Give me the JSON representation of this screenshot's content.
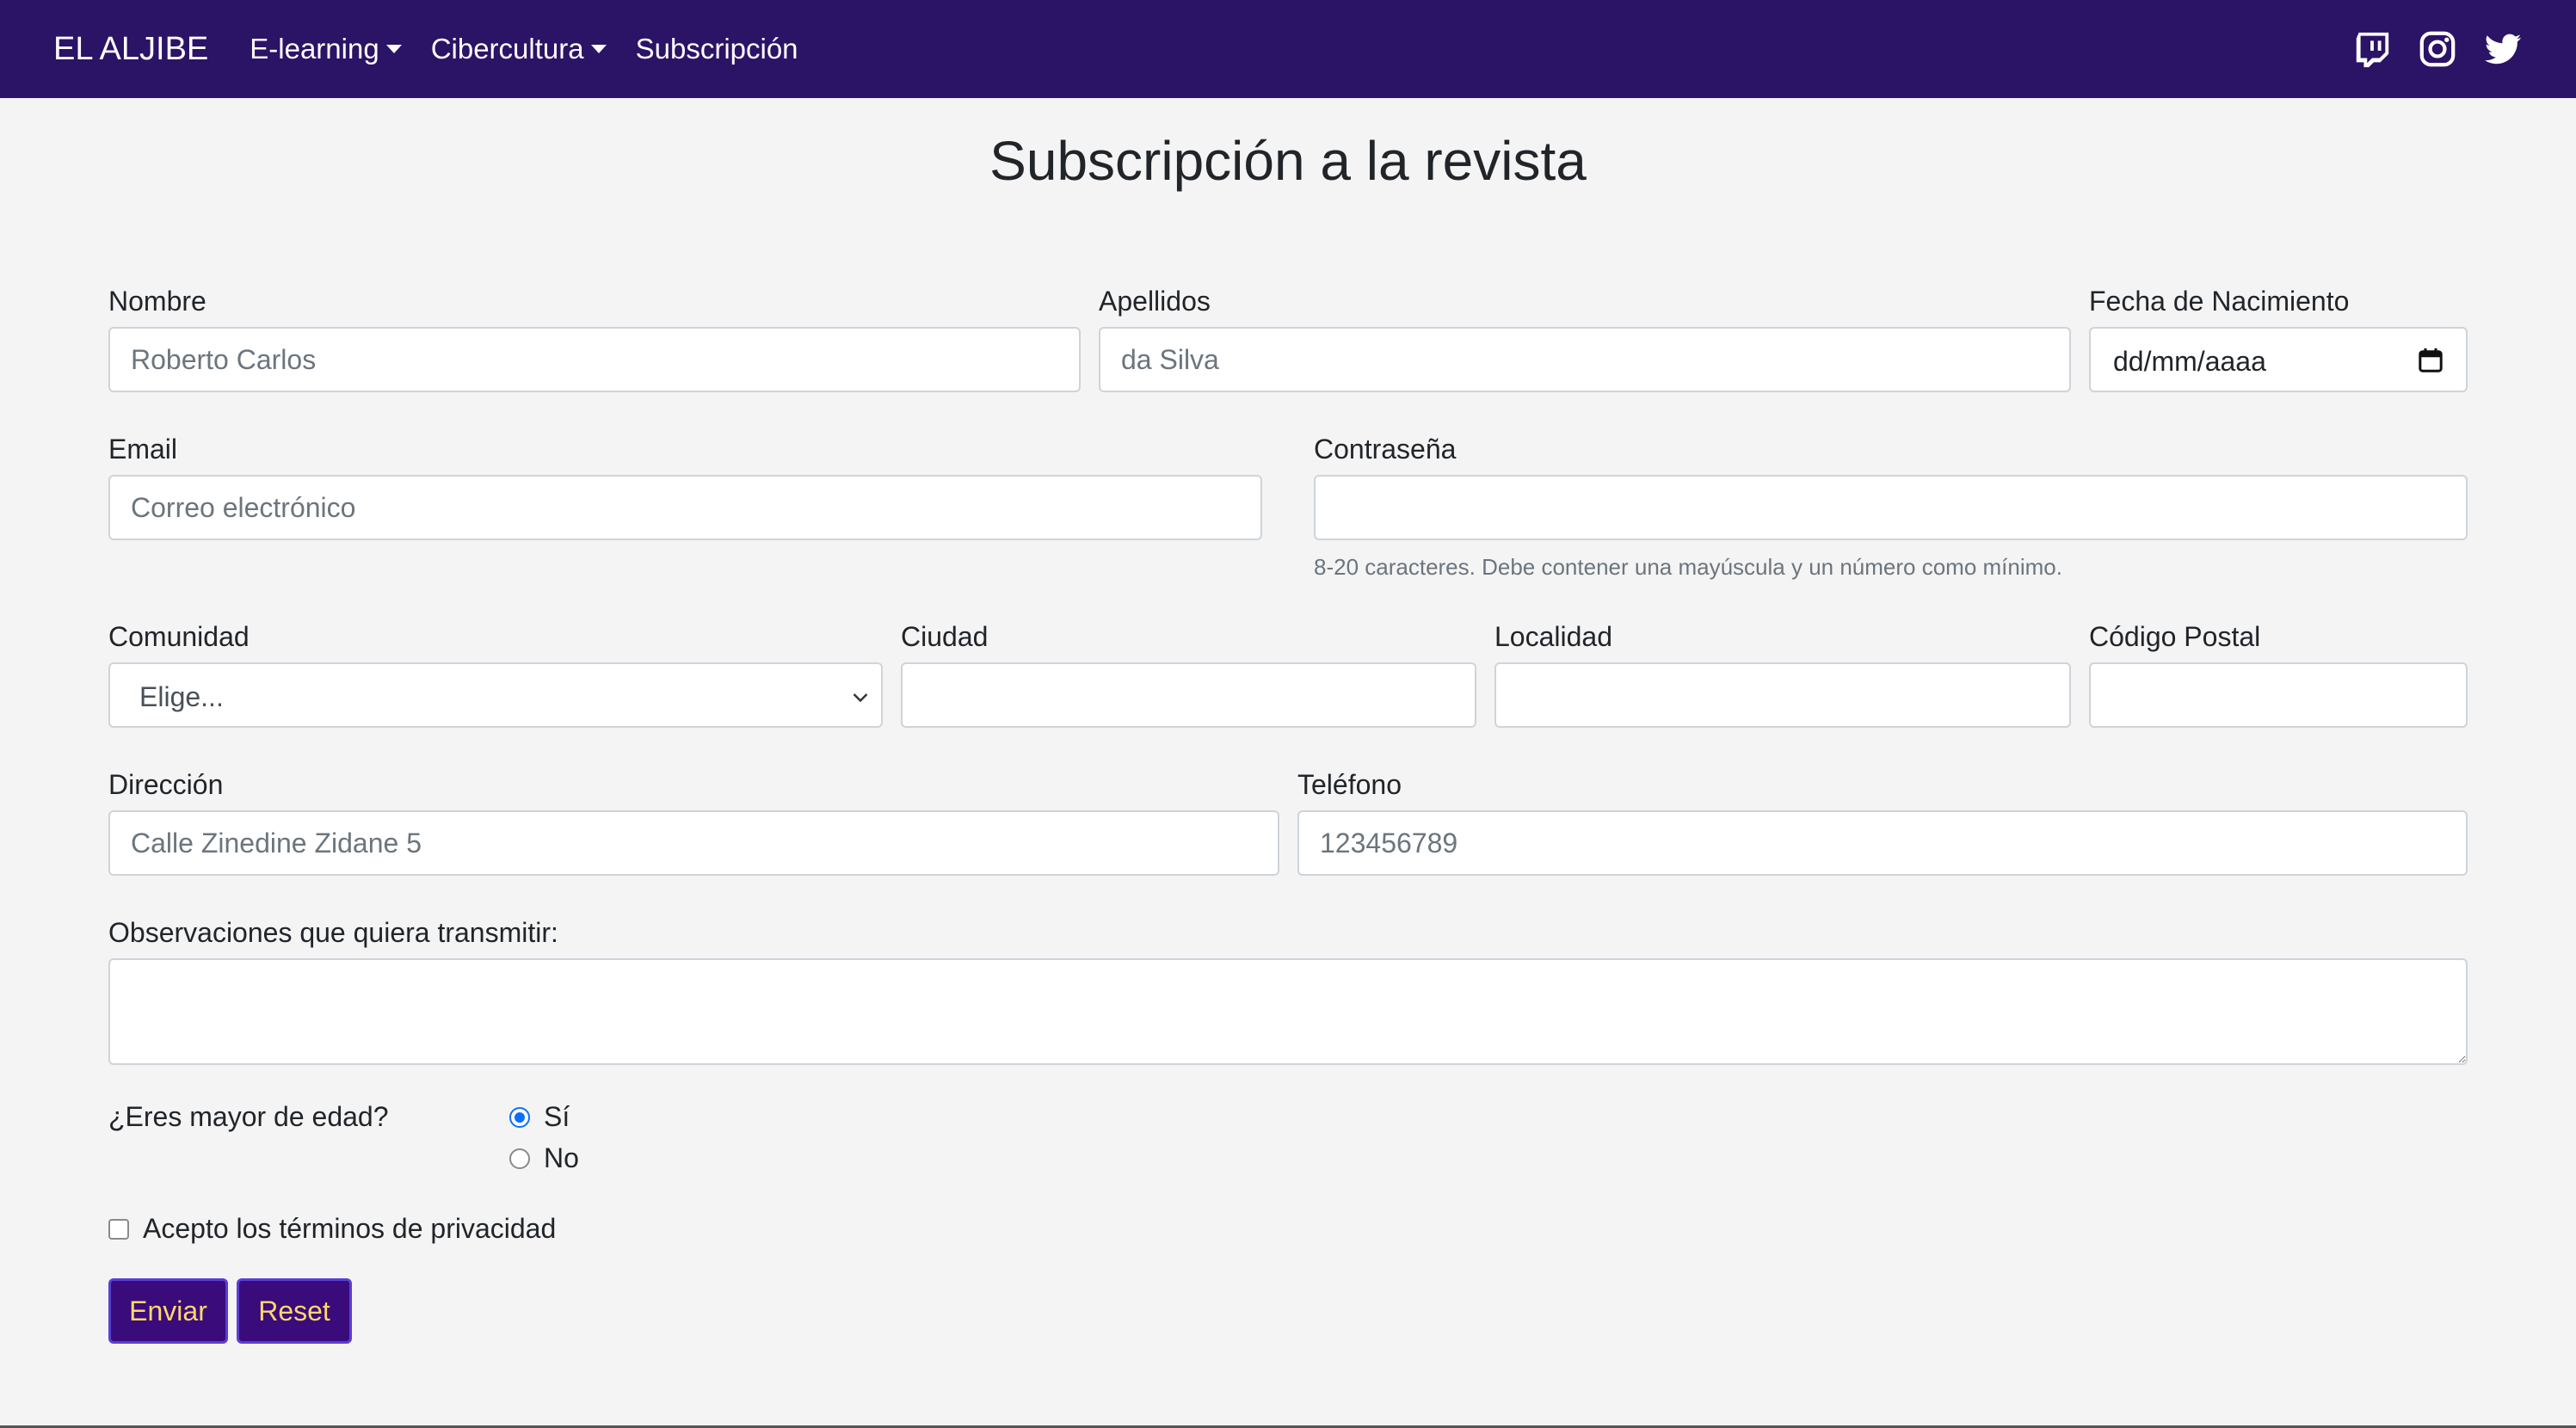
{
  "navbar": {
    "brand": "EL ALJIBE",
    "items": [
      {
        "label": "E-learning",
        "dropdown": true
      },
      {
        "label": "Cibercultura",
        "dropdown": true
      },
      {
        "label": "Subscripción",
        "dropdown": false
      }
    ],
    "icons": [
      "twitch-icon",
      "instagram-icon",
      "twitter-icon"
    ]
  },
  "page": {
    "title": "Subscripción a la revista"
  },
  "form": {
    "nombre": {
      "label": "Nombre",
      "placeholder": "Roberto Carlos"
    },
    "apellidos": {
      "label": "Apellidos",
      "placeholder": "da Silva"
    },
    "fecha": {
      "label": "Fecha de Nacimiento",
      "value": "dd/mm/aaaa"
    },
    "email": {
      "label": "Email",
      "placeholder": "Correo electrónico"
    },
    "password": {
      "label": "Contraseña",
      "help": "8-20 caracteres. Debe contener una mayúscula y un número como mínimo."
    },
    "comunidad": {
      "label": "Comunidad",
      "selected": "Elige..."
    },
    "ciudad": {
      "label": "Ciudad"
    },
    "localidad": {
      "label": "Localidad"
    },
    "codigo_postal": {
      "label": "Código Postal"
    },
    "direccion": {
      "label": "Dirección",
      "placeholder": "Calle Zinedine Zidane 5"
    },
    "telefono": {
      "label": "Teléfono",
      "placeholder": "123456789"
    },
    "observaciones": {
      "label": "Observaciones que quiera transmitir:"
    },
    "mayor_edad": {
      "label": "¿Eres mayor de edad?",
      "options": [
        "Sí",
        "No"
      ],
      "selected": "Sí"
    },
    "terminos": {
      "label": "Acepto los términos de privacidad",
      "checked": false
    },
    "buttons": {
      "submit": "Enviar",
      "reset": "Reset"
    }
  },
  "colors": {
    "navbar": "#2b1366",
    "button_bg": "#3a0b7a",
    "button_text": "#ffd86b",
    "page_bg": "#f4f4f4"
  }
}
